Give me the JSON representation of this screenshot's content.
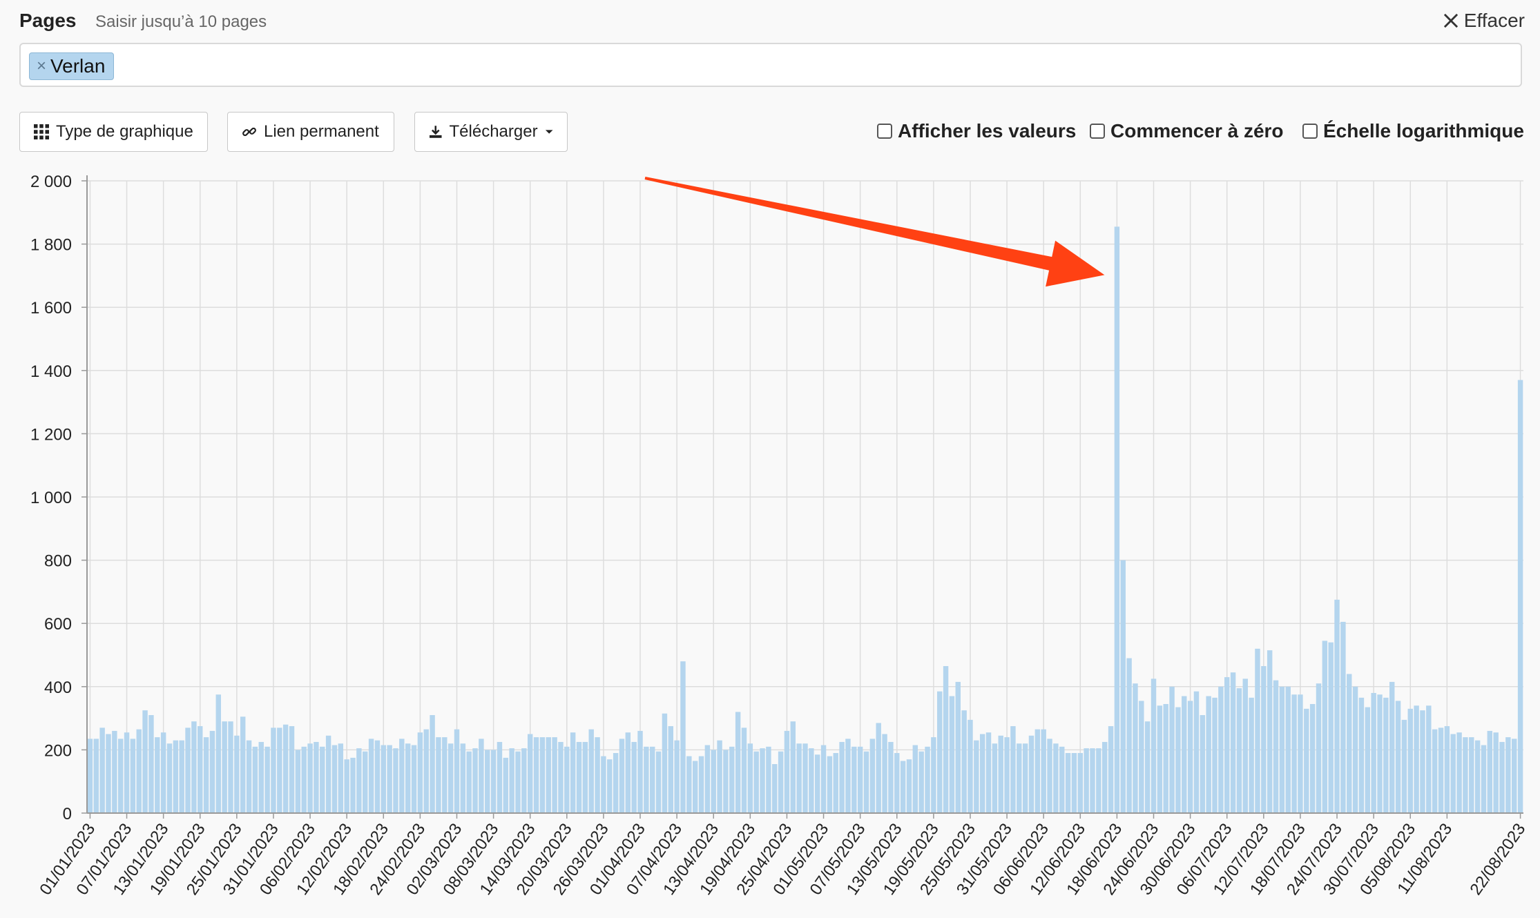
{
  "header": {
    "label": "Pages",
    "hint": "Saisir jusqu’à 10 pages",
    "clear_label": "Effacer"
  },
  "tags": [
    {
      "label": "Verlan",
      "remove_glyph": "×"
    }
  ],
  "toolbar": {
    "chart_type_label": "Type de graphique",
    "permalink_label": "Lien permanent",
    "download_label": "Télécharger",
    "icons": {
      "chart_type": "grid-icon",
      "permalink": "link-icon",
      "download": "download-icon",
      "caret": "caret-down-icon",
      "clear": "close-icon"
    }
  },
  "options": [
    {
      "label": "Afficher les valeurs",
      "checked": false
    },
    {
      "label": "Commencer à zéro",
      "checked": false
    },
    {
      "label": "Échelle logarithmique",
      "checked": false
    }
  ],
  "colors": {
    "bar": "#b4d5ee",
    "grid": "#dddddd",
    "axis": "#999999",
    "arrow": "#ff4113",
    "text": "#222222"
  },
  "chart_data": {
    "type": "bar",
    "x_start": "2023-01-01",
    "x_end": "2023-08-22",
    "ylim": [
      0,
      2000
    ],
    "yticks": [
      0,
      200,
      400,
      600,
      800,
      1000,
      1200,
      1400,
      1600,
      1800,
      2000
    ],
    "ytick_labels": [
      "0",
      "200",
      "400",
      "600",
      "800",
      "1 000",
      "1 200",
      "1 400",
      "1 600",
      "1 800",
      "2 000"
    ],
    "xtick_labels": [
      "01/01/2023",
      "07/01/2023",
      "13/01/2023",
      "19/01/2023",
      "25/01/2023",
      "31/01/2023",
      "06/02/2023",
      "12/02/2023",
      "18/02/2023",
      "24/02/2023",
      "02/03/2023",
      "08/03/2023",
      "14/03/2023",
      "20/03/2023",
      "26/03/2023",
      "01/04/2023",
      "07/04/2023",
      "13/04/2023",
      "19/04/2023",
      "25/04/2023",
      "01/05/2023",
      "07/05/2023",
      "13/05/2023",
      "19/05/2023",
      "25/05/2023",
      "31/05/2023",
      "06/06/2023",
      "12/06/2023",
      "18/06/2023",
      "24/06/2023",
      "30/06/2023",
      "06/07/2023",
      "12/07/2023",
      "18/07/2023",
      "24/07/2023",
      "30/07/2023",
      "05/08/2023",
      "11/08/2023",
      "22/08/2023"
    ],
    "xtick_every_days": 6,
    "values": [
      235,
      235,
      270,
      250,
      260,
      235,
      255,
      235,
      265,
      325,
      310,
      240,
      255,
      220,
      230,
      230,
      270,
      290,
      275,
      240,
      260,
      375,
      290,
      290,
      245,
      305,
      230,
      210,
      225,
      210,
      270,
      270,
      280,
      275,
      200,
      210,
      220,
      225,
      210,
      245,
      215,
      220,
      170,
      175,
      205,
      195,
      235,
      230,
      215,
      215,
      205,
      235,
      220,
      215,
      255,
      265,
      310,
      240,
      240,
      220,
      265,
      220,
      195,
      205,
      235,
      200,
      200,
      225,
      175,
      205,
      195,
      205,
      250,
      240,
      240,
      240,
      240,
      225,
      210,
      255,
      225,
      225,
      265,
      240,
      180,
      170,
      190,
      235,
      255,
      225,
      260,
      210,
      210,
      195,
      315,
      275,
      230,
      480,
      180,
      165,
      180,
      215,
      200,
      230,
      200,
      210,
      320,
      270,
      220,
      195,
      205,
      210,
      155,
      195,
      260,
      290,
      220,
      220,
      205,
      185,
      215,
      180,
      190,
      225,
      235,
      210,
      210,
      195,
      235,
      285,
      250,
      225,
      190,
      165,
      170,
      215,
      195,
      210,
      240,
      385,
      465,
      370,
      415,
      325,
      295,
      230,
      250,
      255,
      220,
      245,
      240,
      275,
      220,
      220,
      245,
      265,
      265,
      235,
      220,
      210,
      190,
      190,
      190,
      205,
      205,
      205,
      225,
      275,
      1855,
      800,
      490,
      410,
      355,
      290,
      425,
      340,
      345,
      400,
      335,
      370,
      355,
      385,
      310,
      370,
      365,
      400,
      430,
      445,
      395,
      425,
      365,
      520,
      465,
      515,
      420,
      400,
      400,
      375,
      375,
      330,
      345,
      410,
      545,
      540,
      675,
      605,
      440,
      400,
      365,
      335,
      380,
      375,
      365,
      415,
      355,
      295,
      330,
      340,
      325,
      340,
      265,
      270,
      275,
      250,
      255,
      240,
      240,
      230,
      215,
      260,
      255,
      225,
      240,
      235,
      1370
    ]
  }
}
